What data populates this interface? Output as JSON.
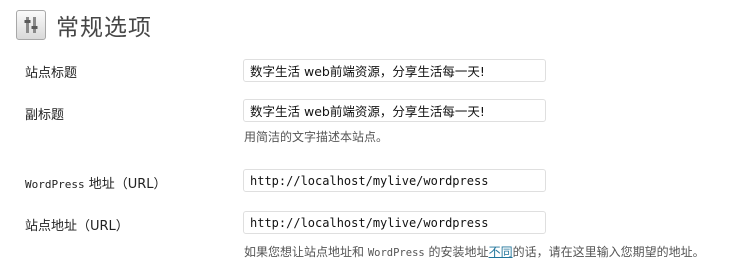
{
  "header": {
    "icon": "settings-sliders-icon",
    "title": "常规选项"
  },
  "site_title": {
    "label": "站点标题",
    "value": "数字生活 web前端资源，分享生活每一天!"
  },
  "tagline": {
    "label": "副标题",
    "value": "数字生活 web前端资源，分享生活每一天!",
    "description": "用简洁的文字描述本站点。"
  },
  "wordpress_address": {
    "label_prefix": "WordPress",
    "label_suffix": " 地址（URL）",
    "value": "http://localhost/mylive/wordpress"
  },
  "site_address": {
    "label": "站点地址（URL）",
    "value": "http://localhost/mylive/wordpress",
    "description_part1": "如果您想让站点地址和 ",
    "description_wp": "WordPress",
    "description_part2": " 的安装地址",
    "description_link": "不同",
    "description_part3": "的话，请在这里输入您期望的地址。"
  }
}
